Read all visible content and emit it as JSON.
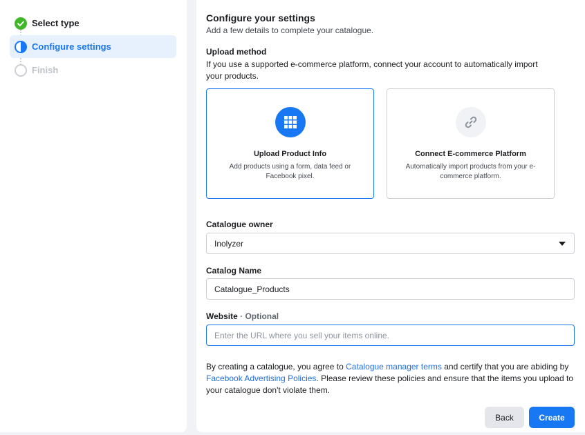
{
  "sidebar": {
    "steps": [
      {
        "label": "Select type",
        "state": "done"
      },
      {
        "label": "Configure settings",
        "state": "active"
      },
      {
        "label": "Finish",
        "state": "todo"
      }
    ]
  },
  "main": {
    "title": "Configure your settings",
    "subtitle": "Add a few details to complete your catalogue.",
    "upload": {
      "title": "Upload method",
      "description": "If you use a supported e-commerce platform, connect your account to automatically import your products.",
      "options": [
        {
          "title": "Upload Product Info",
          "description": "Add products using a form, data feed or Facebook pixel.",
          "icon": "grid-icon",
          "selected": true
        },
        {
          "title": "Connect E-commerce Platform",
          "description": "Automatically import products from your e-commerce platform.",
          "icon": "link-icon",
          "selected": false
        }
      ]
    },
    "owner": {
      "label": "Catalogue owner",
      "value": "Inolyzer"
    },
    "name": {
      "label": "Catalog Name",
      "value": "Catalogue_Products"
    },
    "website": {
      "label": "Website",
      "optional": "· Optional",
      "placeholder": "Enter the URL where you sell your items online."
    },
    "terms": {
      "part1": "By creating a catalogue, you agree to ",
      "link1": "Catalogue manager terms",
      "part2": " and certify that you are abiding by ",
      "link2": "Facebook Advertising Policies",
      "part3": ". Please review these policies and ensure that the items you upload to your catalogue don't violate them."
    },
    "buttons": {
      "back": "Back",
      "create": "Create"
    }
  },
  "colors": {
    "accent": "#1877f2",
    "success": "#42b72a",
    "active_bg": "#e7f0fd"
  }
}
